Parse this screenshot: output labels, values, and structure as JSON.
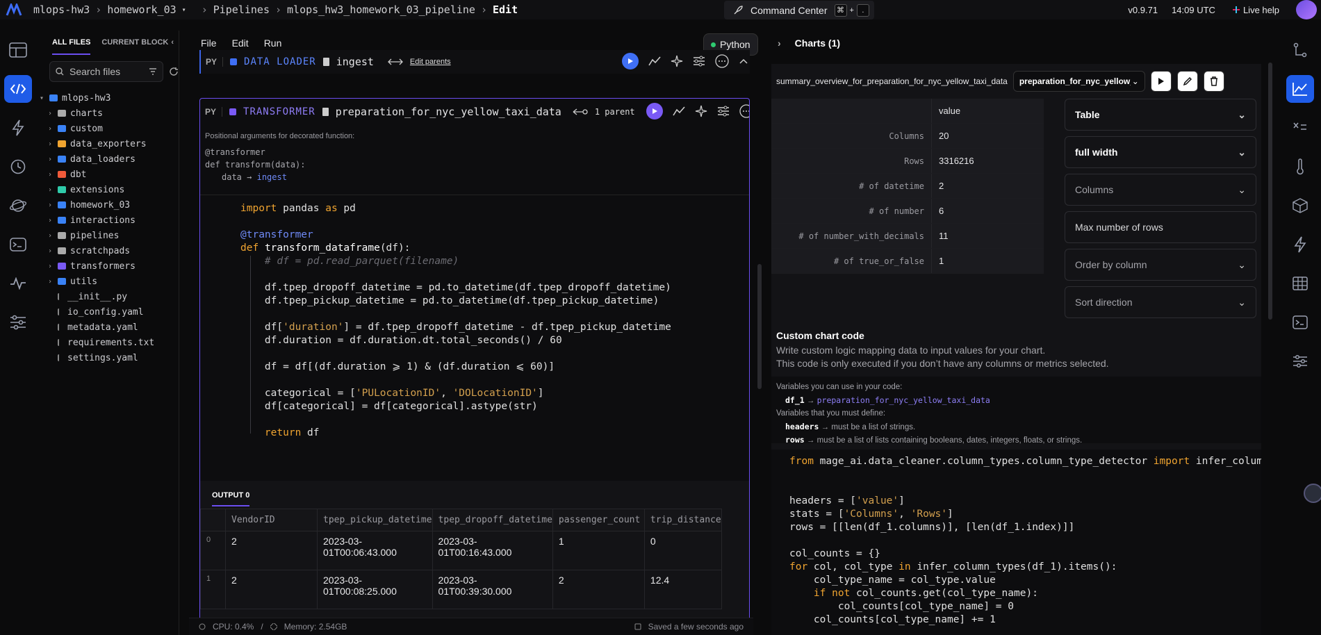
{
  "breadcrumb": {
    "project": "mlops-hw3",
    "folder": "homework_03",
    "pipelines": "Pipelines",
    "pipeline": "mlops_hw3_homework_03_pipeline",
    "mode": "Edit"
  },
  "command_center": {
    "label": "Command Center",
    "key1": "⌘",
    "plus": "+",
    "key2": "."
  },
  "top_right": {
    "version": "v0.9.71",
    "time": "14:09 UTC",
    "live_help": "Live help"
  },
  "file_panel": {
    "tab_all": "ALL FILES",
    "tab_current": "CURRENT BLOCK",
    "search_placeholder": "Search files",
    "root": "mlops-hw3",
    "items": [
      {
        "name": "charts",
        "type": "folder"
      },
      {
        "name": "custom",
        "type": "folder"
      },
      {
        "name": "data_exporters",
        "type": "folder"
      },
      {
        "name": "data_loaders",
        "type": "folder"
      },
      {
        "name": "dbt",
        "type": "folder"
      },
      {
        "name": "extensions",
        "type": "folder"
      },
      {
        "name": "homework_03",
        "type": "folder"
      },
      {
        "name": "interactions",
        "type": "folder"
      },
      {
        "name": "pipelines",
        "type": "folder"
      },
      {
        "name": "scratchpads",
        "type": "folder"
      },
      {
        "name": "transformers",
        "type": "folder"
      },
      {
        "name": "utils",
        "type": "folder"
      },
      {
        "name": "__init__.py",
        "type": "file"
      },
      {
        "name": "io_config.yaml",
        "type": "file"
      },
      {
        "name": "metadata.yaml",
        "type": "file"
      },
      {
        "name": "requirements.txt",
        "type": "file"
      },
      {
        "name": "settings.yaml",
        "type": "file"
      }
    ]
  },
  "menu": {
    "file": "File",
    "edit": "Edit",
    "run": "Run",
    "kernel": "Python"
  },
  "loader_block": {
    "lang": "PY",
    "type": "DATA LOADER",
    "name": "ingest",
    "edit_parents": "Edit parents"
  },
  "transformer_block": {
    "lang": "PY",
    "type": "TRANSFORMER",
    "name": "preparation_for_nyc_yellow_taxi_data",
    "parents": "1 parent",
    "positional_args": "Positional arguments for decorated function:",
    "sig_line1": "@transformer",
    "sig_line2": "def transform(data):",
    "sig_line3_prefix": "data",
    "sig_line3_link": "ingest"
  },
  "output": {
    "tab": "OUTPUT 0",
    "columns": [
      "VendorID",
      "tpep_pickup_datetime",
      "tpep_dropoff_datetime",
      "passenger_count",
      "trip_distance"
    ],
    "rows": [
      {
        "idx": "0",
        "cells": [
          "2",
          "2023-03-01T00:06:43.000",
          "2023-03-01T00:16:43.000",
          "1",
          "0"
        ]
      },
      {
        "idx": "1",
        "cells": [
          "2",
          "2023-03-01T00:08:25.000",
          "2023-03-01T00:39:30.000",
          "2",
          "12.4"
        ]
      }
    ]
  },
  "status": {
    "cpu": "CPU: 0.4%",
    "sep": "/",
    "memory": "Memory: 2.54GB",
    "saved": "Saved a few seconds ago"
  },
  "charts": {
    "header": "Charts (1)",
    "chart_name": "summary_overview_for_preparation_for_nyc_yellow_taxi_data",
    "block_select": "preparation_for_nyc_yellow_taxi_data",
    "value_header": "value",
    "stats": [
      {
        "k": "Columns",
        "v": "20"
      },
      {
        "k": "Rows",
        "v": "3316216"
      },
      {
        "k": "# of datetime",
        "v": "2"
      },
      {
        "k": "# of number",
        "v": "6"
      },
      {
        "k": "# of number_with_decimals",
        "v": "11"
      },
      {
        "k": "# of true_or_false",
        "v": "1"
      }
    ],
    "settings": [
      {
        "label": "Table",
        "style": "bold",
        "dropdown": true
      },
      {
        "label": "full width",
        "style": "bold",
        "dropdown": true
      },
      {
        "label": "Columns",
        "style": "dim",
        "dropdown": true
      },
      {
        "label": "Max number of rows",
        "style": "plain",
        "dropdown": false
      },
      {
        "label": "Order by column",
        "style": "dim",
        "dropdown": true
      },
      {
        "label": "Sort direction",
        "style": "dim",
        "dropdown": true
      }
    ],
    "custom_title": "Custom chart code",
    "custom_desc1": "Write custom logic mapping data to input values for your chart.",
    "custom_desc2": "This code is only executed if you don’t have any columns or metrics selected.",
    "vars_intro": "Variables you can use in your code:",
    "var_df": "df_1",
    "var_df_link": "preparation_for_nyc_yellow_taxi_data",
    "vars_must": "Variables that you must define:",
    "var_headers": "headers",
    "var_headers_desc": "→ must be a list of strings.",
    "var_rows": "rows",
    "var_rows_desc": "→ must be a list of lists containing booleans, dates, integers, floats, or strings."
  },
  "colors": {
    "accent": "#6b4ef0",
    "blue": "#1f5ce8",
    "loader": "#3f6ff5"
  }
}
